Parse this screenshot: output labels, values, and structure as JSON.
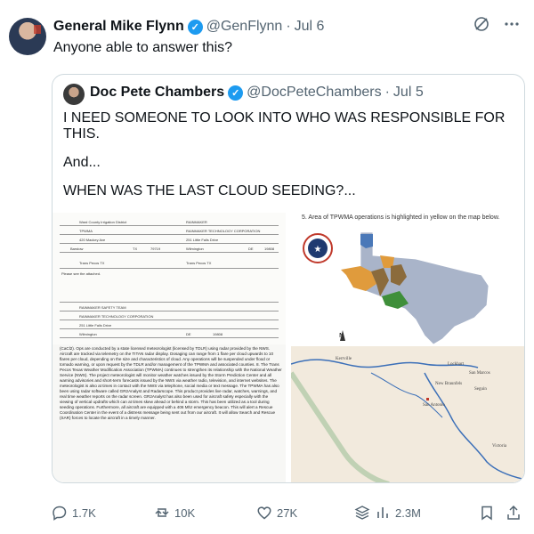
{
  "tweet": {
    "author_name": "General Mike Flynn",
    "author_handle": "@GenFlynn",
    "separator": "·",
    "date": "Jul 6",
    "text": "Anyone able to answer this?"
  },
  "quote": {
    "author_name": "Doc Pete Chambers",
    "author_handle": "@DocPeteChambers",
    "separator": "·",
    "date": "Jul 5",
    "line1": "I NEED SOMEONE TO LOOK INTO WHO WAS RESPONSIBLE FOR THIS.",
    "line2": "And...",
    "line3": "WHEN WAS THE LAST CLOUD SEEDING?..."
  },
  "document": {
    "form_labels": [
      "Ward County Irrigation District",
      "RAINMAKER",
      "TPWMA",
      "RAINMAKER TECHNOLOGY CORPORATION",
      "420 Mackey Ave",
      "251 Little Falls Drive",
      "Barstow",
      "TX",
      "79719",
      "Wilmington",
      "DE",
      "19808",
      "Trans Pecos TX",
      "Trans Pecos TX",
      "Please see the attached.",
      "RAINMAKER SAFETY TEAM",
      "RAINMAKER TECHNOLOGY CORPORATION",
      "251 Little Falls Drive",
      "Wilmington",
      "DE",
      "19808"
    ],
    "body_text": "(CaCl2). Ops are conducted by a state licensed meteorologist (licensed by TDLR) using radar provided by the NWS. Aircraft are tracked via telemetry on the TITAN radar display. Dosaging can range from 1 flare per cloud upwards to 10 flares per cloud, depending on the size and characteristics of cloud. Any operations will be suspended under flood or tornado warning, or upon request by the TDLR and/or management of the TPWMA and associated counties. 8. The Trans Pecos Texas Weather Modification Association (TPWMA) continues to strengthen its relationship with the National Weather Service (NWS). The project meteorologist will monitor weather watches issued by the Storm Prediction Center and all warning advisories and short-term forecasts issued by the NWS via weather radio, television, and internet websites. The meteorologist is also at times in contact with the NWS via telephone, social media or text message. The TPWMA has also been using radar software called GR2Analyst and Radarscope. This product provides live radar, watches, warnings, and real time weather reports on the radar screen. GR2Analyst has also been used for aircraft safety especially with the viewing of vertical updrafts which can at times skew ahead or behind a storm. This has been utilized as a tool during seeding operations. Furthermore, all aircraft are equipped with a 406 Mhz emergency beacon. This will alert a Rescue Coordination Center in the event of a distress message being sent out from our aircraft. It will allow Search and Rescue (SAR) forces to locate the aircraft in a timely manner."
  },
  "map": {
    "caption": "5.  Area of TPWMA operations is highlighted in yellow on the map below.",
    "compass": "N",
    "places": [
      "Kerrville",
      "Lockhart",
      "San Marcos",
      "New Braunfels",
      "Seguin",
      "San Antonio",
      "Victoria"
    ],
    "colors": {
      "state": "#a9b4c9",
      "region_orange": "#e09b3c",
      "region_brown": "#8b6b3c",
      "region_green": "#3f8f3a",
      "region_blue": "#4a78b8",
      "river": "#3b6fb8"
    }
  },
  "actions": {
    "replies": "1.7K",
    "reposts": "10K",
    "likes": "27K",
    "views": "2.3M"
  }
}
